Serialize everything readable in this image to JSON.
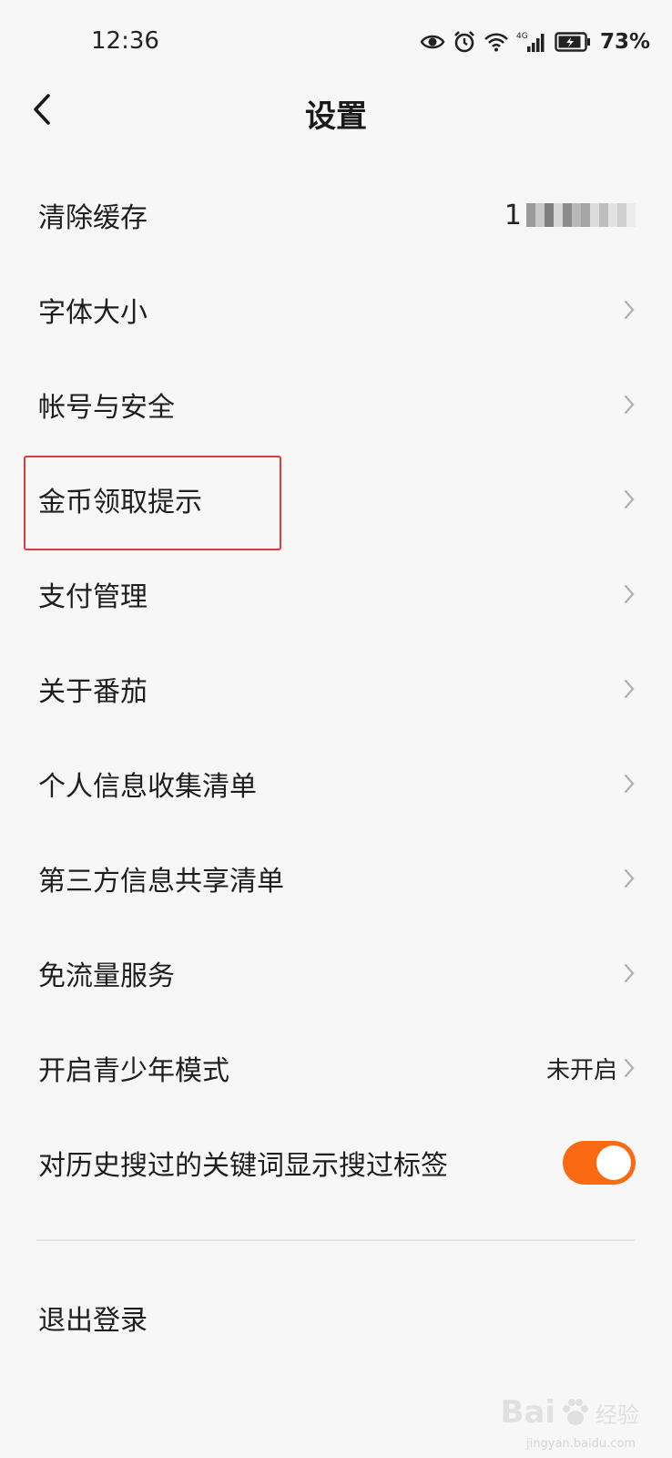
{
  "status_bar": {
    "time": "12:36",
    "network": "4G",
    "battery_percent": "73%",
    "icons": [
      "eye-icon",
      "alarm-icon",
      "wifi-icon",
      "signal-icon",
      "battery-icon"
    ]
  },
  "header": {
    "title": "设置"
  },
  "settings": {
    "clear_cache": {
      "label": "清除缓存",
      "value": "1"
    },
    "font_size": {
      "label": "字体大小"
    },
    "account_security": {
      "label": "帐号与安全"
    },
    "coin_reminder": {
      "label": "金币领取提示"
    },
    "payment": {
      "label": "支付管理"
    },
    "about": {
      "label": "关于番茄"
    },
    "personal_info": {
      "label": "个人信息收集清单"
    },
    "third_party": {
      "label": "第三方信息共享清单"
    },
    "free_data": {
      "label": "免流量服务"
    },
    "teen_mode": {
      "label": "开启青少年模式",
      "value": "未开启"
    },
    "search_tags": {
      "label": "对历史搜过的关键词显示搜过标签",
      "toggle_on": true
    }
  },
  "logout": {
    "label": "退出登录"
  },
  "watermark": {
    "brand": "Bai",
    "sub": "经验",
    "url": "jingyan.baidu.com"
  },
  "colors": {
    "accent": "#fa6a13",
    "highlight": "#e0393a",
    "background": "#f7f7f7"
  }
}
